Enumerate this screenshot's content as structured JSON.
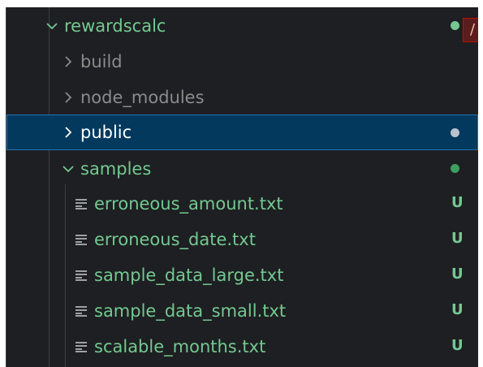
{
  "explorer": {
    "root": {
      "name": "rewardscalc",
      "expanded": true,
      "status": "dot"
    },
    "items": [
      {
        "name": "build",
        "type": "folder",
        "expanded": false,
        "status": ""
      },
      {
        "name": "node_modules",
        "type": "folder",
        "expanded": false,
        "status": ""
      },
      {
        "name": "public",
        "type": "folder",
        "expanded": false,
        "status": "dot",
        "selected": true
      },
      {
        "name": "samples",
        "type": "folder",
        "expanded": true,
        "status": "dot"
      }
    ],
    "files": [
      {
        "name": "erroneous_amount.txt",
        "status": "U"
      },
      {
        "name": "erroneous_date.txt",
        "status": "U"
      },
      {
        "name": "sample_data_large.txt",
        "status": "U"
      },
      {
        "name": "sample_data_small.txt",
        "status": "U"
      },
      {
        "name": "scalable_months.txt",
        "status": "U"
      }
    ],
    "scroll_marker": "/"
  },
  "colors": {
    "untracked": "#73c991",
    "ignored": "#8b8b8b",
    "selection_bg": "#04395e",
    "selection_border": "#1f73b6",
    "background": "#1e1f22"
  }
}
